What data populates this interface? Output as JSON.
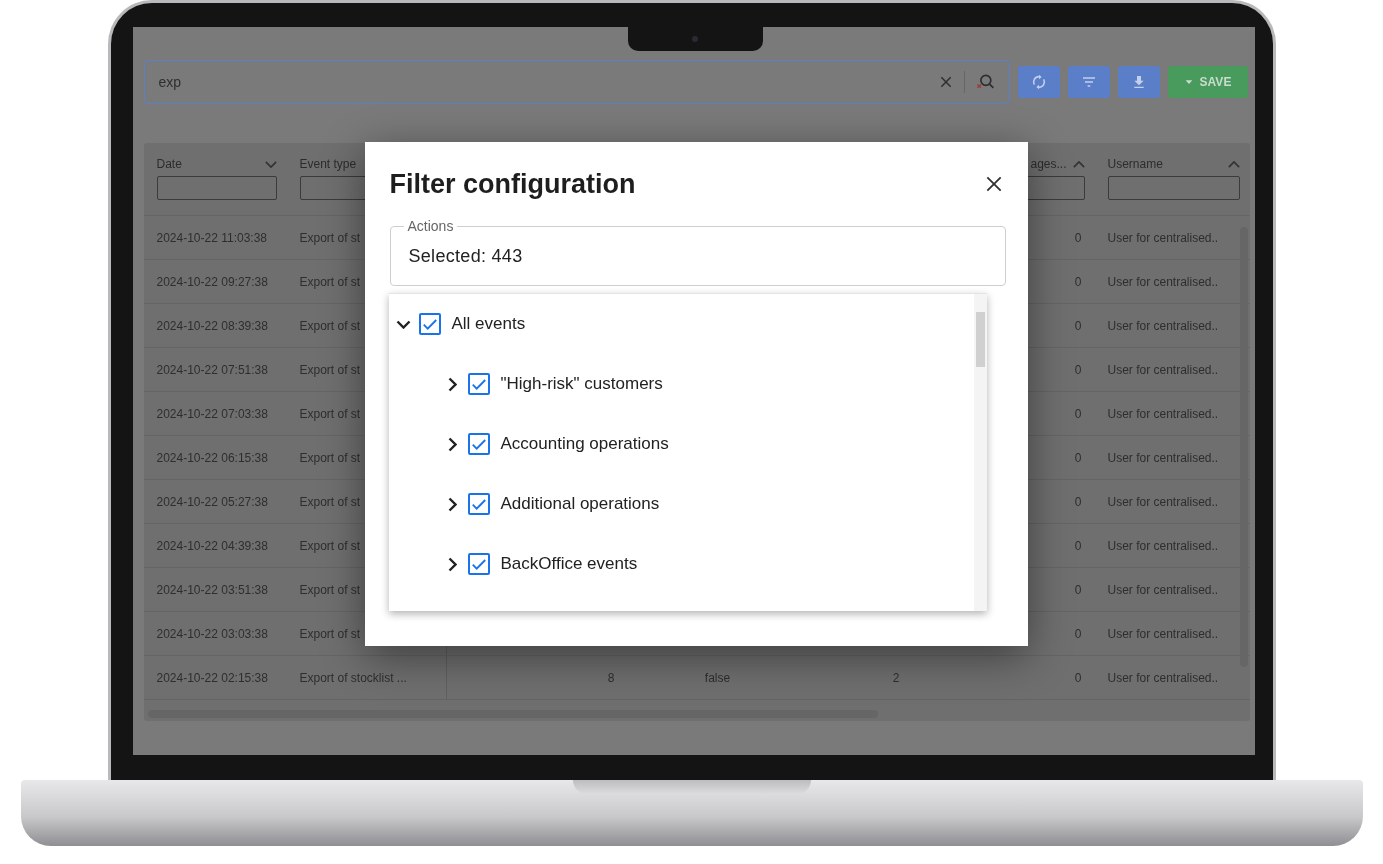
{
  "search": {
    "value": "exp"
  },
  "toolbar": {
    "buttons": [
      {
        "kind": "refresh"
      },
      {
        "kind": "filter"
      },
      {
        "kind": "download"
      },
      {
        "kind": "save",
        "label": "SAVE"
      }
    ]
  },
  "table": {
    "headers": {
      "date": {
        "label": "Date",
        "ascending": false
      },
      "event_type": {
        "label": "Event type"
      },
      "column_6": {
        "label": "ages...",
        "ascending": true
      },
      "username": {
        "label": "Username",
        "ascending": true
      }
    },
    "rows": [
      {
        "date": "2024-10-22 11:03:38",
        "event_type": "Export of st",
        "column_6": "0",
        "username": "User for centralised.."
      },
      {
        "date": "2024-10-22 09:27:38",
        "event_type": "Export of st",
        "column_6": "0",
        "username": "User for centralised.."
      },
      {
        "date": "2024-10-22 08:39:38",
        "event_type": "Export of st",
        "column_6": "0",
        "username": "User for centralised.."
      },
      {
        "date": "2024-10-22 07:51:38",
        "event_type": "Export of st",
        "column_6": "0",
        "username": "User for centralised.."
      },
      {
        "date": "2024-10-22 07:03:38",
        "event_type": "Export of st",
        "column_6": "0",
        "username": "User for centralised.."
      },
      {
        "date": "2024-10-22 06:15:38",
        "event_type": "Export of st",
        "column_6": "0",
        "username": "User for centralised.."
      },
      {
        "date": "2024-10-22 05:27:38",
        "event_type": "Export of st",
        "column_6": "0",
        "username": "User for centralised.."
      },
      {
        "date": "2024-10-22 04:39:38",
        "event_type": "Export of st",
        "column_6": "0",
        "username": "User for centralised.."
      },
      {
        "date": "2024-10-22 03:51:38",
        "event_type": "Export of st",
        "column_6": "0",
        "username": "User for centralised.."
      },
      {
        "date": "2024-10-22 03:03:38",
        "event_type": "Export of st",
        "column_6": "0",
        "username": "User for centralised.."
      },
      {
        "date": "2024-10-22 02:15:38",
        "event_type": "Export of stocklist ...",
        "column_3": "8",
        "column_4": "false",
        "column_5": "2",
        "column_6": "0",
        "username": "User for centralised.."
      }
    ]
  },
  "dialog": {
    "title": "Filter configuration",
    "field": {
      "label": "Actions",
      "value": "Selected: 443"
    },
    "tree": [
      {
        "label": "All events",
        "checked": true,
        "expanded": true,
        "children": [
          {
            "label": "\"High-risk\" customers",
            "checked": true,
            "expanded": false
          },
          {
            "label": "Accounting operations",
            "checked": true,
            "expanded": false
          },
          {
            "label": "Additional operations",
            "checked": true,
            "expanded": false
          },
          {
            "label": "BackOffice events",
            "checked": true,
            "expanded": false
          }
        ]
      }
    ]
  }
}
